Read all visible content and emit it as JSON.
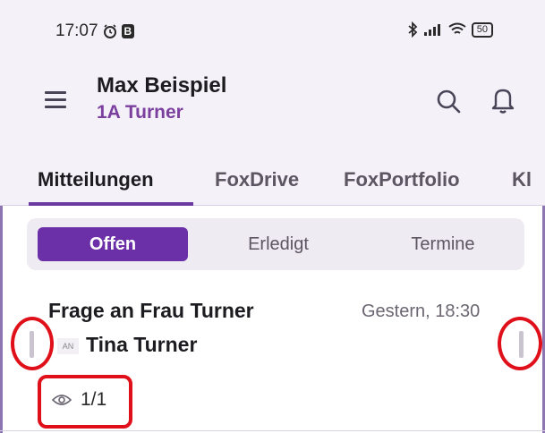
{
  "status_bar": {
    "time": "17:07",
    "alarm_icon": "alarm-icon",
    "b_badge": "B",
    "battery": "50"
  },
  "app_bar": {
    "user_name": "Max Beispiel",
    "class_name": "1A Turner"
  },
  "tabs": [
    {
      "label": "Mitteilungen",
      "active": true
    },
    {
      "label": "FoxDrive",
      "active": false
    },
    {
      "label": "FoxPortfolio",
      "active": false
    },
    {
      "label": "Kl",
      "active": false
    }
  ],
  "filters": [
    {
      "label": "Offen",
      "active": true
    },
    {
      "label": "Erledigt",
      "active": false
    },
    {
      "label": "Termine",
      "active": false
    }
  ],
  "message": {
    "title": "Frage an Frau Turner",
    "date": "Gestern, 18:30",
    "sender_badge": "AN",
    "sender": "Tina Turner",
    "read_count": "1/1"
  },
  "colors": {
    "accent": "#6b2fa8",
    "class_text": "#7b3f9e",
    "annotation": "#e0101a",
    "header_bg": "#f4f1f9"
  }
}
